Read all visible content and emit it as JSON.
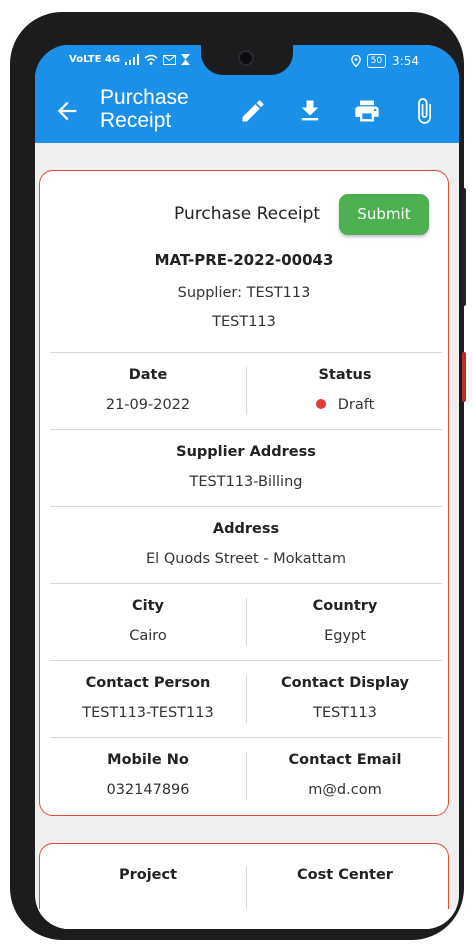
{
  "status_bar": {
    "left_icons": "VoLTE 4G",
    "battery": "50",
    "time": "3:54"
  },
  "app_bar": {
    "title": "Purchase Receipt"
  },
  "receipt": {
    "heading": "Purchase Receipt",
    "submit_label": "Submit",
    "number": "MAT-PRE-2022-00043",
    "supplier": "Supplier: TEST113",
    "supplier_name": "TEST113",
    "date_label": "Date",
    "date_value": "21-09-2022",
    "status_label": "Status",
    "status_value": "Draft",
    "supplier_address_label": "Supplier Address",
    "supplier_address_value": "TEST113-Billing",
    "address_label": "Address",
    "address_value": "El Quods Street - Mokattam",
    "city_label": "City",
    "city_value": "Cairo",
    "country_label": "Country",
    "country_value": "Egypt",
    "contact_person_label": "Contact Person",
    "contact_person_value": "TEST113-TEST113",
    "contact_display_label": "Contact Display",
    "contact_display_value": "TEST113",
    "mobile_label": "Mobile No",
    "mobile_value": "032147896",
    "email_label": "Contact Email",
    "email_value": "m@d.com"
  },
  "second_card": {
    "project_label": "Project",
    "cost_center_label": "Cost Center"
  },
  "colors": {
    "app_bar": "#1a90e8",
    "submit": "#4caf50",
    "card_border": "#e04b3a",
    "status_dot": "#e53935"
  },
  "icons": [
    "back-arrow-icon",
    "edit-pencil-icon",
    "download-icon",
    "print-icon",
    "attachment-icon",
    "wifi-icon",
    "signal-icon",
    "location-icon",
    "battery-icon"
  ]
}
